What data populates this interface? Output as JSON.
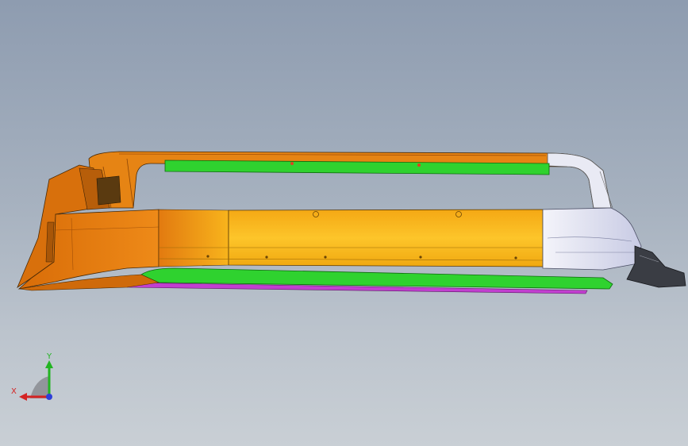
{
  "viewport": {
    "background_top": "#8e9cb0",
    "background_bottom": "#c9cfd5"
  },
  "model": {
    "parts": [
      {
        "name": "orange-frame",
        "color": "#e07a10"
      },
      {
        "name": "yellow-panel",
        "color": "#f6b91a"
      },
      {
        "name": "white-end-panel",
        "color": "#e6e8f2"
      },
      {
        "name": "green-top-rail",
        "color": "#2fd22f"
      },
      {
        "name": "green-bottom-rail",
        "color": "#2fd22f"
      },
      {
        "name": "magenta-strip",
        "color": "#c23fd0"
      },
      {
        "name": "dark-end-bracket",
        "color": "#3a3d44"
      }
    ]
  },
  "triad": {
    "x_label": "X",
    "y_label": "Y",
    "x_color": "#d42424",
    "y_color": "#22b422",
    "z_color": "#2e3fd8"
  }
}
